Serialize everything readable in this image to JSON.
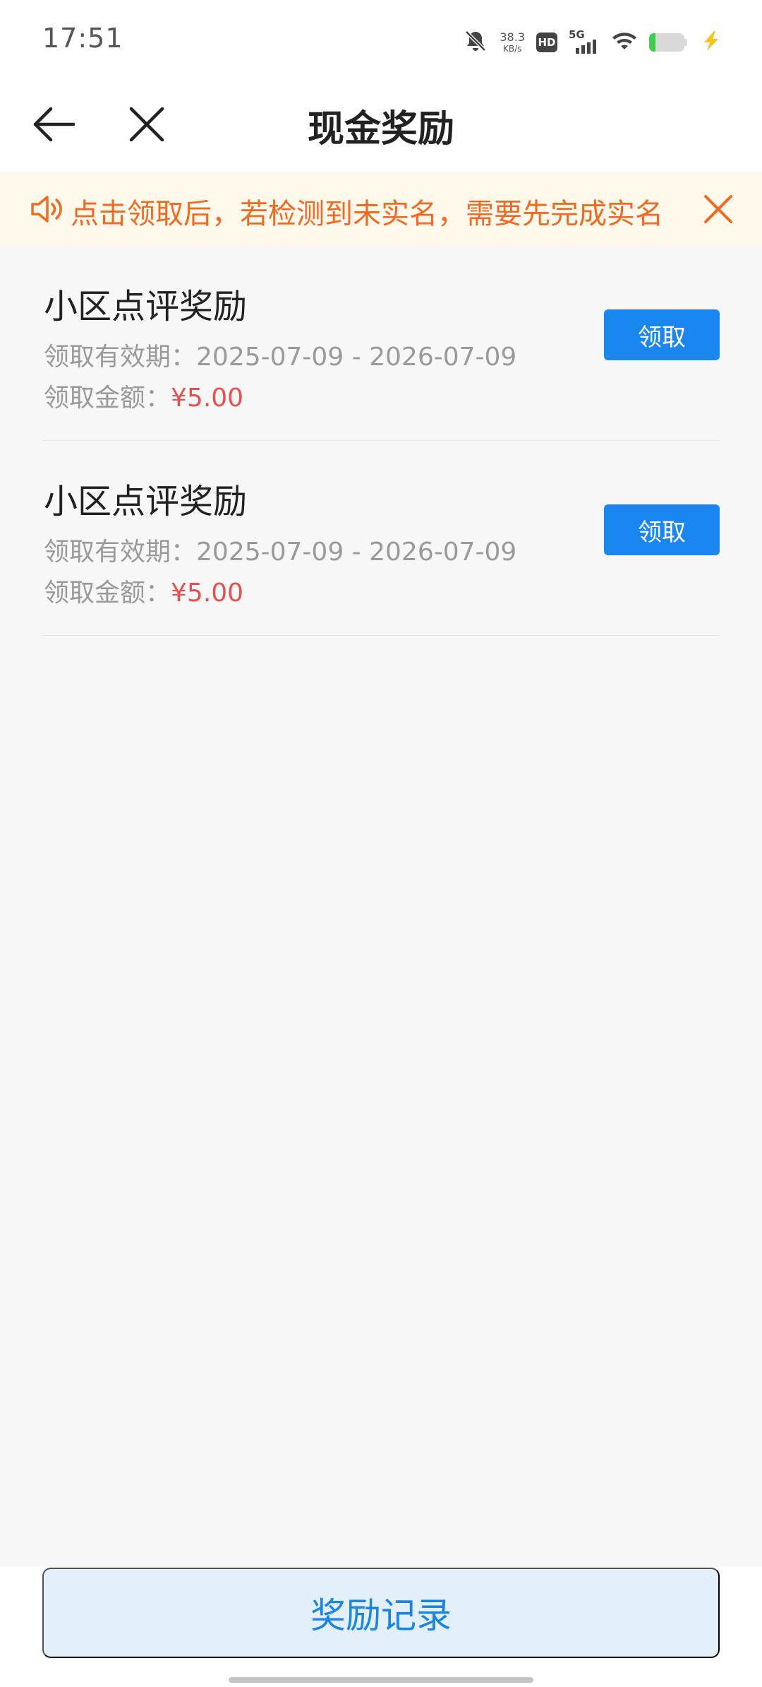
{
  "status_bar": {
    "time": "17:51",
    "net_speed_value": "38.3",
    "net_speed_unit": "KB/s",
    "hd_label": "HD",
    "network_label": "5G",
    "icons": [
      "mute-bell-icon",
      "hd-icon",
      "signal-5g-icon",
      "wifi-icon",
      "battery-icon",
      "charging-bolt-icon"
    ],
    "battery_level_percent": 18
  },
  "nav": {
    "title": "现金奖励",
    "icons": [
      "back-arrow-icon",
      "close-icon"
    ]
  },
  "notice": {
    "text": "点击领取后，若检测到未实名，需要先完成实名",
    "icons": [
      "speaker-icon",
      "close-icon"
    ],
    "color": "#ef6a22"
  },
  "rewards": [
    {
      "title": "小区点评奖励",
      "validity_label": "领取有效期：",
      "validity": "2025-07-09 - 2026-07-09",
      "amount_label": "领取金额：",
      "amount": "¥5.00",
      "button": "领取"
    },
    {
      "title": "小区点评奖励",
      "validity_label": "领取有效期：",
      "validity": "2025-07-09 - 2026-07-09",
      "amount_label": "领取金额：",
      "amount": "¥5.00",
      "button": "领取"
    }
  ],
  "footer": {
    "records_button": "奖励记录"
  },
  "colors": {
    "accent": "#1a86f0",
    "amount": "#e85050",
    "notice_bg": "#fff9ec"
  }
}
